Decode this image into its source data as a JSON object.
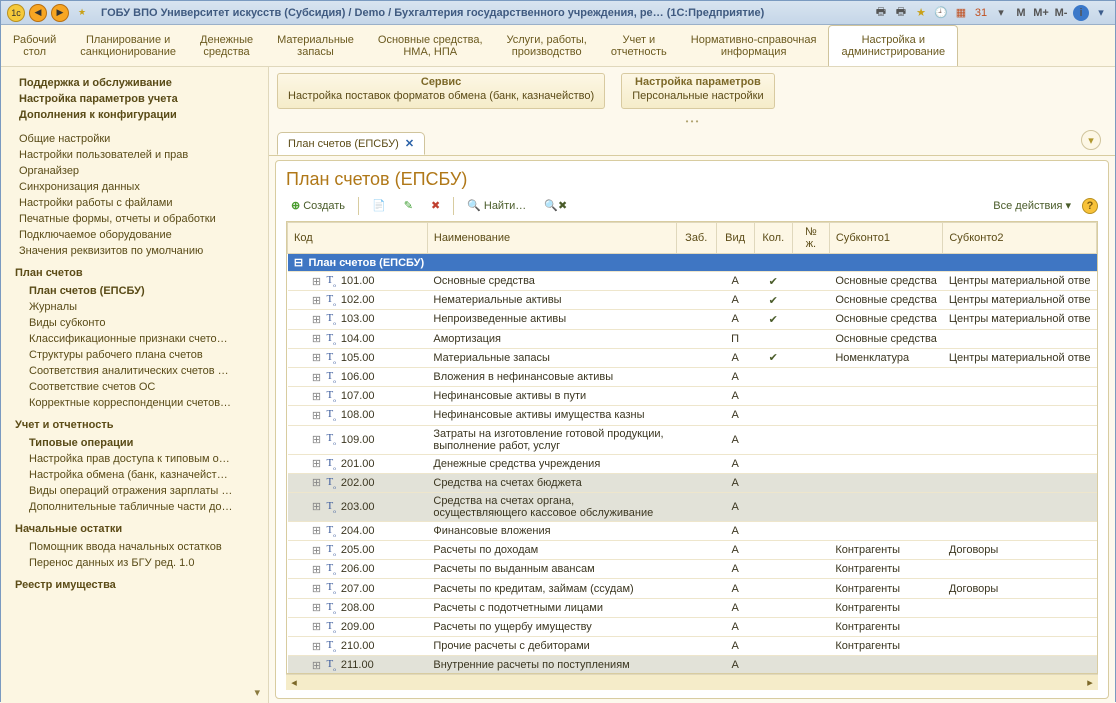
{
  "titlebar": {
    "title": "ГОБУ ВПО Университет искусств (Субсидия) / Demo / Бухгалтерия государственного учреждения, ре…   (1С:Предприятие)",
    "m": "M",
    "mplus": "M+",
    "mminus": "M-"
  },
  "mainmenu": [
    {
      "l1": "Рабочий",
      "l2": "стол"
    },
    {
      "l1": "Планирование и",
      "l2": "санкционирование"
    },
    {
      "l1": "Денежные",
      "l2": "средства"
    },
    {
      "l1": "Материальные",
      "l2": "запасы"
    },
    {
      "l1": "Основные средства,",
      "l2": "НМА, НПА"
    },
    {
      "l1": "Услуги, работы,",
      "l2": "производство"
    },
    {
      "l1": "Учет и",
      "l2": "отчетность"
    },
    {
      "l1": "Нормативно-справочная",
      "l2": "информация"
    },
    {
      "l1": "Настройка и",
      "l2": "администрирование",
      "active": true
    }
  ],
  "sidebar": {
    "top": [
      {
        "t": "Поддержка и обслуживание",
        "b": true
      },
      {
        "t": "Настройка параметров учета",
        "b": true
      },
      {
        "t": "Дополнения к конфигурации",
        "b": true
      }
    ],
    "g1": [
      {
        "t": "Общие настройки"
      },
      {
        "t": "Настройки пользователей и прав"
      },
      {
        "t": "Органайзер"
      },
      {
        "t": "Синхронизация данных"
      },
      {
        "t": "Настройки работы с файлами"
      },
      {
        "t": "Печатные формы, отчеты и обработки"
      },
      {
        "t": "Подключаемое оборудование"
      },
      {
        "t": "Значения реквизитов по умолчанию"
      }
    ],
    "g2_title": "План счетов",
    "g2": [
      {
        "t": "План счетов (ЕПСБУ)",
        "b": true
      },
      {
        "t": "Журналы"
      },
      {
        "t": "Виды субконто"
      },
      {
        "t": "Классификационные признаки счето…"
      },
      {
        "t": "Структуры рабочего плана счетов"
      },
      {
        "t": "Соответствия аналитических счетов …"
      },
      {
        "t": "Соответствие счетов ОС"
      },
      {
        "t": "Корректные корреспонденции счетов…"
      }
    ],
    "g3_title": "Учет и отчетность",
    "g3": [
      {
        "t": "Типовые операции",
        "b": true
      },
      {
        "t": "Настройка прав доступа к типовым о…"
      },
      {
        "t": "Настройка обмена (банк, казначейст…"
      },
      {
        "t": "Виды операций отражения зарплаты …"
      },
      {
        "t": "Дополнительные табличные части до…"
      }
    ],
    "g4_title": "Начальные остатки",
    "g4": [
      {
        "t": "Помощник ввода начальных остатков"
      },
      {
        "t": "Перенос данных из БГУ ред. 1.0"
      }
    ],
    "g5_title": "Реестр имущества"
  },
  "svc": {
    "b1_hd": "Сервис",
    "b1_ln": "Настройка поставок форматов обмена (банк, казначейство)",
    "b2_hd": "Настройка параметров",
    "b2_ln": "Персональные настройки"
  },
  "tab": {
    "label": "План счетов (ЕПСБУ)"
  },
  "panel": {
    "title": "План счетов (ЕПСБУ)",
    "create": "Создать",
    "find": "Найти…",
    "all_actions": "Все действия"
  },
  "cols": {
    "code": "Код",
    "name": "Наименование",
    "zab": "Заб.",
    "vid": "Вид",
    "kol": "Кол.",
    "nzh": "№ ж.",
    "s1": "Субконто1",
    "s2": "Субконто2"
  },
  "rootrow": "План счетов (ЕПСБУ)",
  "rows": [
    {
      "code": "101.00",
      "name": "Основные средства",
      "vid": "А",
      "kol": true,
      "s1": "Основные средства",
      "s2": "Центры материальной отве"
    },
    {
      "code": "102.00",
      "name": "Нематериальные активы",
      "vid": "А",
      "kol": true,
      "s1": "Основные средства",
      "s2": "Центры материальной отве"
    },
    {
      "code": "103.00",
      "name": "Непроизведенные активы",
      "vid": "А",
      "kol": true,
      "s1": "Основные средства",
      "s2": "Центры материальной отве"
    },
    {
      "code": "104.00",
      "name": "Амортизация",
      "vid": "П",
      "s1": "Основные средства"
    },
    {
      "code": "105.00",
      "name": "Материальные запасы",
      "vid": "А",
      "kol": true,
      "s1": "Номенклатура",
      "s2": "Центры материальной отве"
    },
    {
      "code": "106.00",
      "name": "Вложения в нефинансовые активы",
      "vid": "А"
    },
    {
      "code": "107.00",
      "name": "Нефинансовые активы в пути",
      "vid": "А"
    },
    {
      "code": "108.00",
      "name": "Нефинансовые активы имущества казны",
      "vid": "А"
    },
    {
      "code": "109.00",
      "name": "Затраты на изготовление готовой продукции, выполнение работ, услуг",
      "vid": "А",
      "wrap": true
    },
    {
      "code": "201.00",
      "name": "Денежные средства учреждения",
      "vid": "А"
    },
    {
      "code": "202.00",
      "name": "Средства на счетах бюджета",
      "vid": "А",
      "dim": true
    },
    {
      "code": "203.00",
      "name": "Средства на счетах органа, осуществляющего кассовое обслуживание",
      "vid": "А",
      "dim": true,
      "wrap": true
    },
    {
      "code": "204.00",
      "name": "Финансовые вложения",
      "vid": "А"
    },
    {
      "code": "205.00",
      "name": "Расчеты по доходам",
      "vid": "А",
      "s1": "Контрагенты",
      "s2": "Договоры"
    },
    {
      "code": "206.00",
      "name": "Расчеты по выданным авансам",
      "vid": "А",
      "s1": "Контрагенты"
    },
    {
      "code": "207.00",
      "name": "Расчеты по кредитам, займам (ссудам)",
      "vid": "А",
      "s1": "Контрагенты",
      "s2": "Договоры"
    },
    {
      "code": "208.00",
      "name": "Расчеты с подотчетными лицами",
      "vid": "А",
      "s1": "Контрагенты"
    },
    {
      "code": "209.00",
      "name": "Расчеты по ущербу имуществу",
      "vid": "А",
      "s1": "Контрагенты"
    },
    {
      "code": "210.00",
      "name": "Прочие расчеты с дебиторами",
      "vid": "А",
      "s1": "Контрагенты"
    },
    {
      "code": "211.00",
      "name": "Внутренние расчеты по поступлениям",
      "vid": "А",
      "dim": true
    }
  ]
}
